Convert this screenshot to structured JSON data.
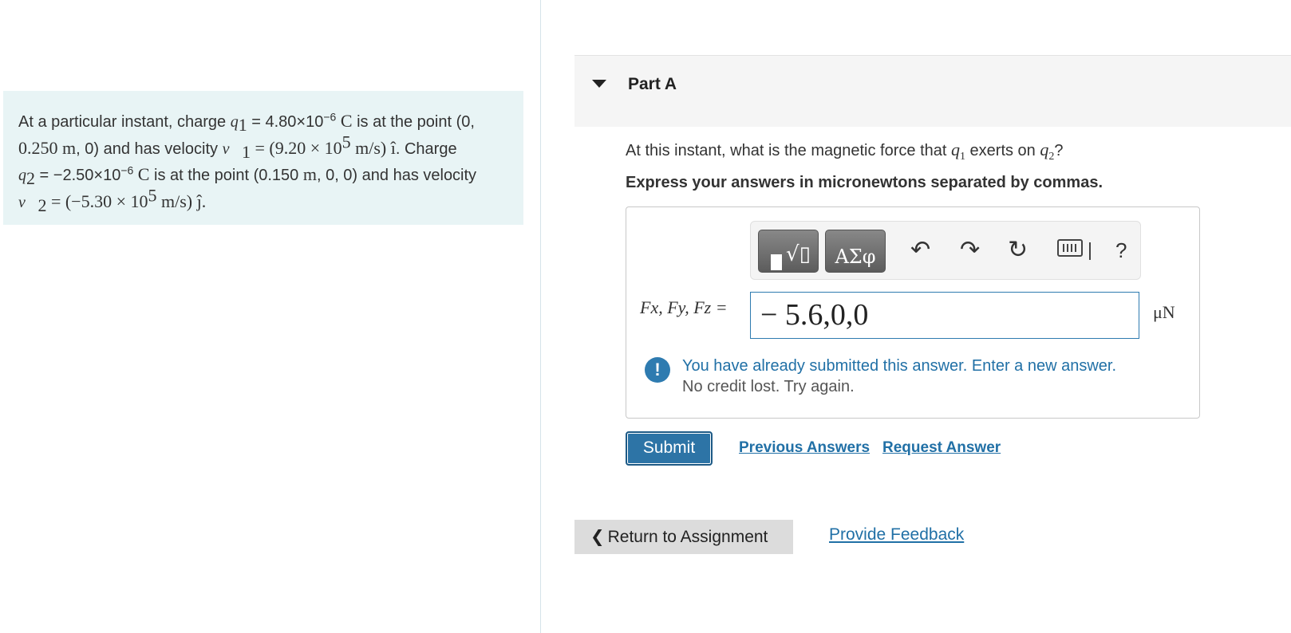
{
  "problem": {
    "t1": "At a particular instant, charge ",
    "q1": "q",
    "q1_sub": "1",
    "t2": " = 4.80×10",
    "q1_exp": "−6",
    "unit_C": " C",
    "t3": " is at the point (0,",
    "t4": "0.250 m",
    "t5": ", 0) and has velocity ",
    "v1": "v⃗",
    "v1_sub": "1",
    "v1_eq": " = (9.20 × 10",
    "v1_exp": "5",
    "v1_unit": " m/s) î",
    "t6": ". Charge",
    "q2": "q",
    "q2_sub": "2",
    "t7": " = −2.50×10",
    "q2_exp": "−6",
    "t8": " C",
    "t9": " is at the point (0.150 ",
    "t9_m": "m",
    "t10": ", 0, 0) and has velocity",
    "v2": "v⃗",
    "v2_sub": "2",
    "v2_eq": " = (−5.30 × 10",
    "v2_exp": "5",
    "v2_unit": " m/s) ĵ."
  },
  "part": {
    "title": "Part A",
    "question_pre": "At this instant, what is the magnetic force that ",
    "question_q1": "q",
    "question_q1_sub": "1",
    "question_mid": " exerts on ",
    "question_q2": "q",
    "question_q2_sub": "2",
    "question_end": "?",
    "instruction": "Express your answers in micronewtons separated by commas."
  },
  "toolbar": {
    "symbols_label": "ΑΣφ",
    "undo_icon": "↶",
    "redo_icon": "↷",
    "reset_icon": "↻",
    "help_label": "?"
  },
  "answer": {
    "var_label": "Fx, Fy, Fz =",
    "value": "− 5.6,0,0",
    "unit": "μN"
  },
  "feedback": {
    "icon": "!",
    "message": "You have already submitted this answer. Enter a new answer.",
    "sub": "No credit lost. Try again."
  },
  "actions": {
    "submit": "Submit",
    "previous_answers": "Previous Answers",
    "request_answer": "Request Answer",
    "return": "Return to Assignment",
    "provide_feedback": "Provide Feedback"
  },
  "colors": {
    "accent": "#2d74a6",
    "link": "#2170a6",
    "problem_bg": "#e8f4f5"
  }
}
